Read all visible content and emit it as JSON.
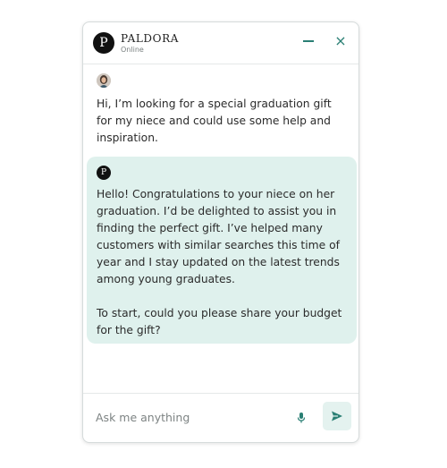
{
  "header": {
    "logo_letter": "P",
    "brand": "PALDORA",
    "status": "Online"
  },
  "messages": {
    "user": {
      "text": "Hi, I’m looking for a special graduation gift for my niece and could use some help and inspiration."
    },
    "bot": {
      "avatar_letter": "P",
      "paragraph_1": "Hello! Congratulations to your niece on her graduation. I’d be delighted to assist you in finding the perfect gift. I’ve helped many customers with similar searches this time of year and I stay updated on the latest trends among young graduates.",
      "paragraph_2": "To start, could you please share your budget for the gift?"
    }
  },
  "footer": {
    "placeholder": "Ask me anything"
  },
  "icons": {
    "close": "×"
  },
  "colors": {
    "accent": "#2a7f74",
    "bot_bubble": "#dff1ed",
    "send_button_bg": "#e4f2ef"
  }
}
